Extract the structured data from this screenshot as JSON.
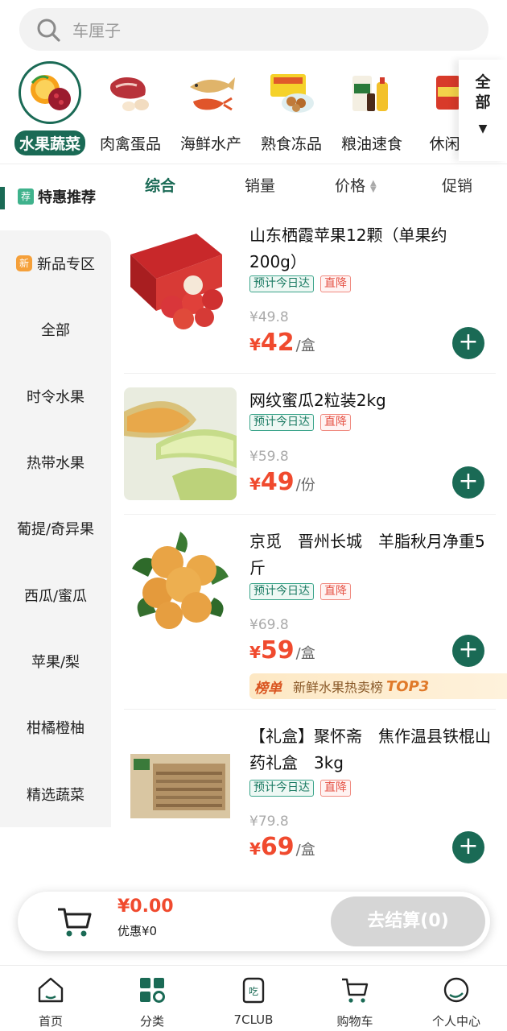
{
  "search": {
    "placeholder": "车厘子"
  },
  "categories": [
    {
      "label": "水果蔬菜",
      "active": true
    },
    {
      "label": "肉禽蛋品"
    },
    {
      "label": "海鲜水产"
    },
    {
      "label": "熟食冻品"
    },
    {
      "label": "粮油速食"
    },
    {
      "label": "休闲零"
    }
  ],
  "all_categories": {
    "line1": "全",
    "line2": "部",
    "arrow": "▼"
  },
  "sidebar": {
    "header": {
      "badge": "荐",
      "label": "特惠推荐"
    },
    "items": [
      "新品专区",
      "全部",
      "时令水果",
      "热带水果",
      "葡提/奇异果",
      "西瓜/蜜瓜",
      "苹果/梨",
      "柑橘橙柚",
      "精选蔬菜"
    ],
    "new_badge": "新"
  },
  "sort": {
    "items": [
      "综合",
      "销量",
      "价格",
      "促销"
    ]
  },
  "products": [
    {
      "title": "山东栖霞苹果12颗（单果约200g）",
      "tag1": "预计今日达",
      "tag2": "直降",
      "orig": "¥49.8",
      "cur": "¥",
      "price": "42",
      "unit": "/盒"
    },
    {
      "title": "网纹蜜瓜2粒装2kg",
      "tag1": "预计今日达",
      "tag2": "直降",
      "orig": "¥59.8",
      "cur": "¥",
      "price": "49",
      "unit": "/份"
    },
    {
      "title": "京觅　晋州长城　羊脂秋月净重5斤",
      "tag1": "预计今日达",
      "tag2": "直降",
      "orig": "¥69.8",
      "cur": "¥",
      "price": "59",
      "unit": "/盒",
      "rank": {
        "label": "榜单",
        "text": "新鲜水果热卖榜",
        "top": "TOP3",
        "arrow": "›"
      }
    },
    {
      "title": "【礼盒】聚怀斋　焦作温县铁棍山药礼盒　3kg",
      "tag1": "预计今日达",
      "tag2": "直降",
      "orig": "¥79.8",
      "cur": "¥",
      "price": "69",
      "unit": "/盒"
    }
  ],
  "add_symbol": "+",
  "cart": {
    "total": "¥0.00",
    "discount": "优惠¥0",
    "checkout": "去结算(0)"
  },
  "nav": [
    {
      "label": "首页"
    },
    {
      "label": "分类"
    },
    {
      "label": "7CLUB"
    },
    {
      "label": "购物车"
    },
    {
      "label": "个人中心"
    }
  ],
  "colors": {
    "brand": "#1a6a55",
    "price": "#f04a2e"
  }
}
